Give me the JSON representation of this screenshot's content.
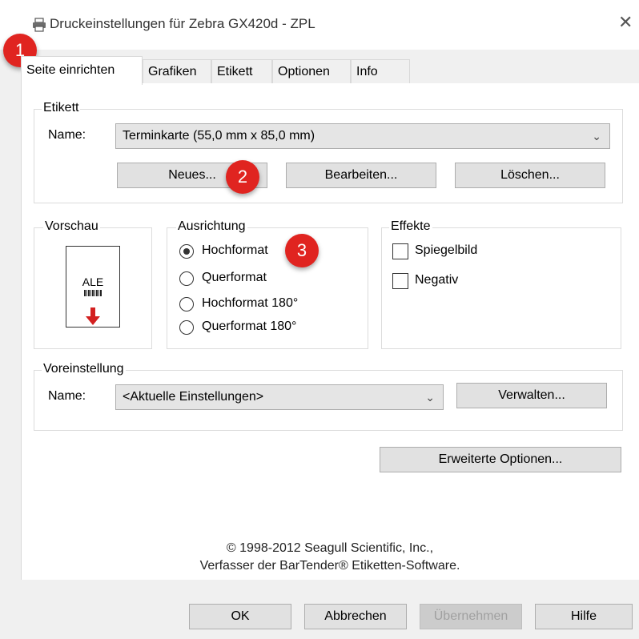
{
  "window": {
    "title": "Druckeinstellungen für Zebra GX420d - ZPL",
    "close_glyph": "✕"
  },
  "tabs": [
    {
      "label": "Seite einrichten"
    },
    {
      "label": "Grafiken"
    },
    {
      "label": "Etikett"
    },
    {
      "label": "Optionen"
    },
    {
      "label": "Info"
    }
  ],
  "etikett": {
    "group_label": "Etikett",
    "name_label": "Name:",
    "name_value": "Terminkarte (55,0 mm x 85,0 mm)",
    "new_button": "Neues...",
    "edit_button": "Bearbeiten...",
    "delete_button": "Löschen..."
  },
  "vorschau": {
    "group_label": "Vorschau",
    "card_text": "ALE"
  },
  "ausrichtung": {
    "group_label": "Ausrichtung",
    "options": [
      {
        "label": "Hochformat",
        "selected": true
      },
      {
        "label": "Querformat",
        "selected": false
      },
      {
        "label": "Hochformat 180°",
        "selected": false
      },
      {
        "label": "Querformat 180°",
        "selected": false
      }
    ]
  },
  "effekte": {
    "group_label": "Effekte",
    "options": [
      {
        "label": "Spiegelbild",
        "checked": false
      },
      {
        "label": "Negativ",
        "checked": false
      }
    ]
  },
  "voreinstellung": {
    "group_label": "Voreinstellung",
    "name_label": "Name:",
    "name_value": "<Aktuelle Einstellungen>",
    "manage_button": "Verwalten..."
  },
  "advanced_button": "Erweiterte Optionen...",
  "footer": {
    "line1": "© 1998-2012 Seagull Scientific, Inc.,",
    "line2": "Verfasser der BarTender® Etiketten-Software."
  },
  "dialog_buttons": {
    "ok": "OK",
    "cancel": "Abbrechen",
    "apply": "Übernehmen",
    "help": "Hilfe"
  },
  "annotations": {
    "badge1": "1",
    "badge2": "2",
    "badge3": "3",
    "color": "#e02420"
  },
  "colors": {
    "accent_red": "#e02420",
    "panel_bg": "#f0f0f0",
    "page_bg": "#ffffff"
  }
}
